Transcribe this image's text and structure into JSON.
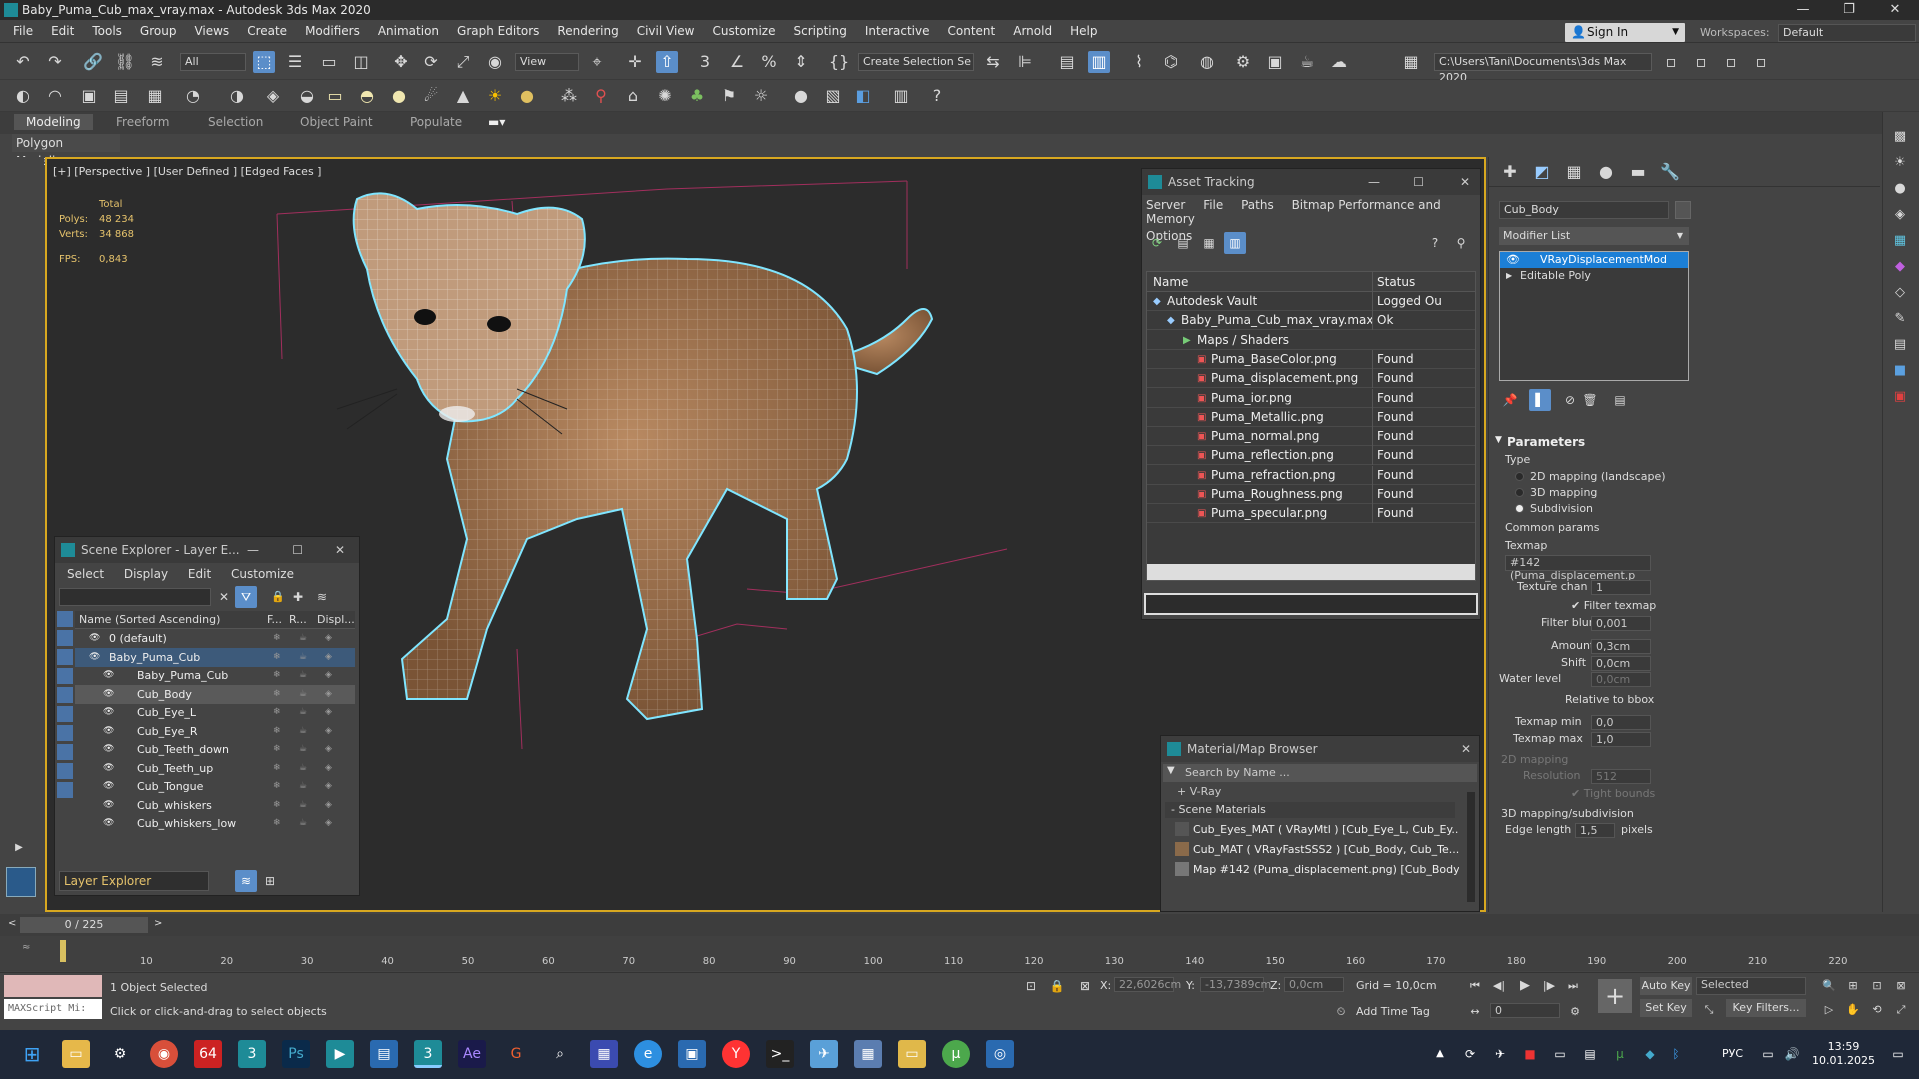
{
  "window": {
    "title": "Baby_Puma_Cub_max_vray.max - Autodesk 3ds Max 2020",
    "minimize": "—",
    "maximize": "❐",
    "close": "✕"
  },
  "menu": [
    "File",
    "Edit",
    "Tools",
    "Group",
    "Views",
    "Create",
    "Modifiers",
    "Animation",
    "Graph Editors",
    "Rendering",
    "Civil View",
    "Customize",
    "Scripting",
    "Interactive",
    "Content",
    "Arnold",
    "Help"
  ],
  "signin": "Sign In",
  "workspaces_label": "Workspaces:",
  "workspace_value": "Default",
  "toolbar": {
    "filter_select": "All",
    "view_select": "View",
    "create_selection": "Create Selection Se",
    "path": "C:\\Users\\Tani\\Documents\\3ds Max 2020"
  },
  "ribbon_tabs": [
    "Modeling",
    "Freeform",
    "Selection",
    "Object Paint",
    "Populate"
  ],
  "ribbon_sub": "Polygon Modeling",
  "viewport": {
    "label": "[+] [Perspective ] [User Defined ] [Edged Faces ]",
    "stats_total": "Total",
    "polys_label": "Polys:",
    "polys": "48 234",
    "verts_label": "Verts:",
    "verts": "34 868",
    "fps_label": "FPS:",
    "fps": "0,843"
  },
  "asset_tracking": {
    "title": "Asset Tracking",
    "menu": [
      "Server",
      "File",
      "Paths",
      "Bitmap Performance and Memory"
    ],
    "menu2": "Options",
    "col_name": "Name",
    "col_status": "Status",
    "rows": [
      {
        "name": "Autodesk Vault",
        "status": "Logged Ou"
      },
      {
        "name": "Baby_Puma_Cub_max_vray.max",
        "status": "Ok"
      },
      {
        "name": "Maps / Shaders",
        "status": ""
      },
      {
        "name": "Puma_BaseColor.png",
        "status": "Found"
      },
      {
        "name": "Puma_displacement.png",
        "status": "Found"
      },
      {
        "name": "Puma_ior.png",
        "status": "Found"
      },
      {
        "name": "Puma_Metallic.png",
        "status": "Found"
      },
      {
        "name": "Puma_normal.png",
        "status": "Found"
      },
      {
        "name": "Puma_reflection.png",
        "status": "Found"
      },
      {
        "name": "Puma_refraction.png",
        "status": "Found"
      },
      {
        "name": "Puma_Roughness.png",
        "status": "Found"
      },
      {
        "name": "Puma_specular.png",
        "status": "Found"
      }
    ]
  },
  "scene_explorer": {
    "title": "Scene Explorer - Layer E...",
    "menu": [
      "Select",
      "Display",
      "Edit",
      "Customize"
    ],
    "col_name": "Name (Sorted Ascending)",
    "col_f": "F...",
    "col_r": "R...",
    "col_d": "Displ...",
    "rows": [
      "0 (default)",
      "Baby_Puma_Cub",
      "Baby_Puma_Cub",
      "Cub_Body",
      "Cub_Eye_L",
      "Cub_Eye_R",
      "Cub_Teeth_down",
      "Cub_Teeth_up",
      "Cub_Tongue",
      "Cub_whiskers",
      "Cub_whiskers_low"
    ],
    "footer": "Layer Explorer"
  },
  "material_browser": {
    "title": "Material/Map Browser",
    "search_placeholder": "Search by Name ...",
    "vray": "+ V-Ray",
    "scene_materials": "- Scene Materials",
    "items": [
      "Cub_Eyes_MAT ( VRayMtl ) [Cub_Eye_L, Cub_Ey...",
      "Cub_MAT ( VRayFastSSS2 ) [Cub_Body, Cub_Te...",
      "Map #142 (Puma_displacement.png) [Cub_Body]"
    ]
  },
  "command_panel": {
    "object_name": "Cub_Body",
    "modifier_list": "Modifier List",
    "stack": [
      "VRayDisplacementMod",
      "Editable Poly"
    ],
    "parameters": "Parameters",
    "type_label": "Type",
    "type_options": [
      "2D mapping (landscape)",
      "3D mapping",
      "Subdivision"
    ],
    "common_params": "Common params",
    "texmap_label": "Texmap",
    "texmap_value": "#142 (Puma_displacement.p",
    "texture_chan_label": "Texture chan",
    "texture_chan": "1",
    "filter_texmap": "Filter texmap",
    "filter_blur_label": "Filter blur",
    "filter_blur": "0,001",
    "amount_label": "Amount",
    "amount": "0,3cm",
    "shift_label": "Shift",
    "shift": "0,0cm",
    "water_level_label": "Water level",
    "water_level": "0,0cm",
    "relative_bbox": "Relative to bbox",
    "texmap_min_label": "Texmap min",
    "texmap_min": "0,0",
    "texmap_max_label": "Texmap max",
    "texmap_max": "1,0",
    "mapping_2d": "2D mapping",
    "resolution_label": "Resolution",
    "resolution": "512",
    "tight_bounds": "Tight bounds",
    "mapping_3d": "3D mapping/subdivision",
    "edge_length_label": "Edge length",
    "edge_length": "1,5",
    "pixels": "pixels"
  },
  "time": {
    "frame": "0 / 225",
    "ticks": [
      "10",
      "20",
      "30",
      "40",
      "50",
      "60",
      "70",
      "80",
      "90",
      "100",
      "110",
      "120",
      "130",
      "140",
      "150",
      "160",
      "170",
      "180",
      "190",
      "200",
      "210",
      "220"
    ]
  },
  "status": {
    "maxscript": "MAXScript Mi:",
    "selected": "1 Object Selected",
    "hint": "Click or click-and-drag to select objects",
    "x_label": "X:",
    "x": "22,6026cm",
    "y_label": "Y:",
    "y": "-13,7389cm",
    "z_label": "Z:",
    "z": "0,0cm",
    "grid": "Grid = 10,0cm",
    "add_time_tag": "Add Time Tag",
    "auto_key": "Auto Key",
    "set_key": "Set Key",
    "selected_dd": "Selected",
    "key_filters": "Key Filters...",
    "frame_field": "0"
  },
  "taskbar": {
    "lang": "РУС",
    "time": "13:59",
    "date": "10.01.2025"
  },
  "colors": {
    "accent": "#5b8ec9",
    "viewport_border": "#d8a820",
    "selection_blue": "#1c7fd6"
  }
}
